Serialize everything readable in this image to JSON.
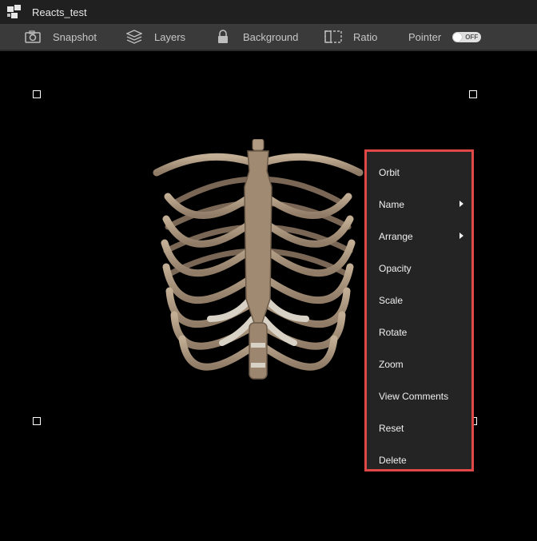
{
  "app": {
    "title": "Reacts_test"
  },
  "toolbar": {
    "snapshot_label": "Snapshot",
    "layers_label": "Layers",
    "background_label": "Background",
    "ratio_label": "Ratio",
    "pointer_label": "Pointer",
    "pointer_toggle_text": "OFF"
  },
  "context_menu": {
    "items": [
      {
        "label": "Orbit",
        "submenu": false
      },
      {
        "label": "Name",
        "submenu": true
      },
      {
        "label": "Arrange",
        "submenu": true
      },
      {
        "label": "Opacity",
        "submenu": false
      },
      {
        "label": "Scale",
        "submenu": false
      },
      {
        "label": "Rotate",
        "submenu": false
      },
      {
        "label": "Zoom",
        "submenu": false
      },
      {
        "label": "View Comments",
        "submenu": false
      },
      {
        "label": "Reset",
        "submenu": false
      },
      {
        "label": "Delete",
        "submenu": false
      }
    ],
    "highlight_color": "#e04848"
  },
  "icons": {
    "logo": "app-logo-icon",
    "snapshot": "camera-icon",
    "layers": "layers-icon",
    "background": "lock-icon",
    "ratio": "ratio-icon",
    "submenu": "chevron-right-icon"
  },
  "colors": {
    "titlebar_bg": "#202020",
    "toolbar_bg": "#3a3a3a",
    "canvas_bg": "#000000",
    "menu_bg": "#242424",
    "bone": "#b8a48c"
  }
}
